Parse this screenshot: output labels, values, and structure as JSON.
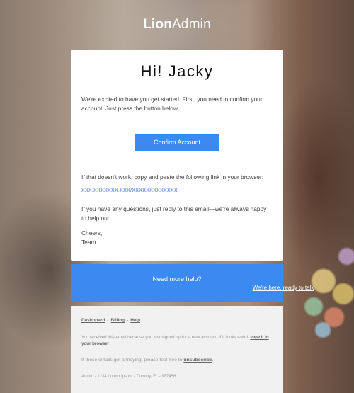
{
  "brand": {
    "bold": "Lion",
    "regular": "Admin"
  },
  "card": {
    "greeting": "Hi! Jacky",
    "intro": "We're excited to have you get started. First, you need to confirm your account. Just press the button below.",
    "button_label": "Confirm Account",
    "copy_text": "If that doesn't work, copy and paste the following link in your browser:",
    "link_text": "XXX.XXXXXXX.XXX/XXXXXXXXXXXXX",
    "questions": "If you have any questions, just reply to this email—we're always happy to help out.",
    "cheers": "Cheers,",
    "team": "Team"
  },
  "help": {
    "title": "Need more help?",
    "link": "We're here, ready to talk"
  },
  "footer": {
    "nav": [
      "Dashboard",
      "Billing",
      "Help"
    ],
    "separator": "-",
    "notice": "You received this email because you just signed up for a new account. If it looks weird,",
    "notice_link": "view it in your browser",
    "notice_end": ".",
    "annoying": "If these emails get annoying, please feel free to",
    "unsubscribe": "unsubscribe",
    "unsubscribe_end": ".",
    "address": "Admin - 1234 Lorem Ipsum - Dummy, FL - 987456"
  },
  "colors": {
    "accent": "#3b8af2",
    "footer_bg": "#f1f1f1"
  }
}
